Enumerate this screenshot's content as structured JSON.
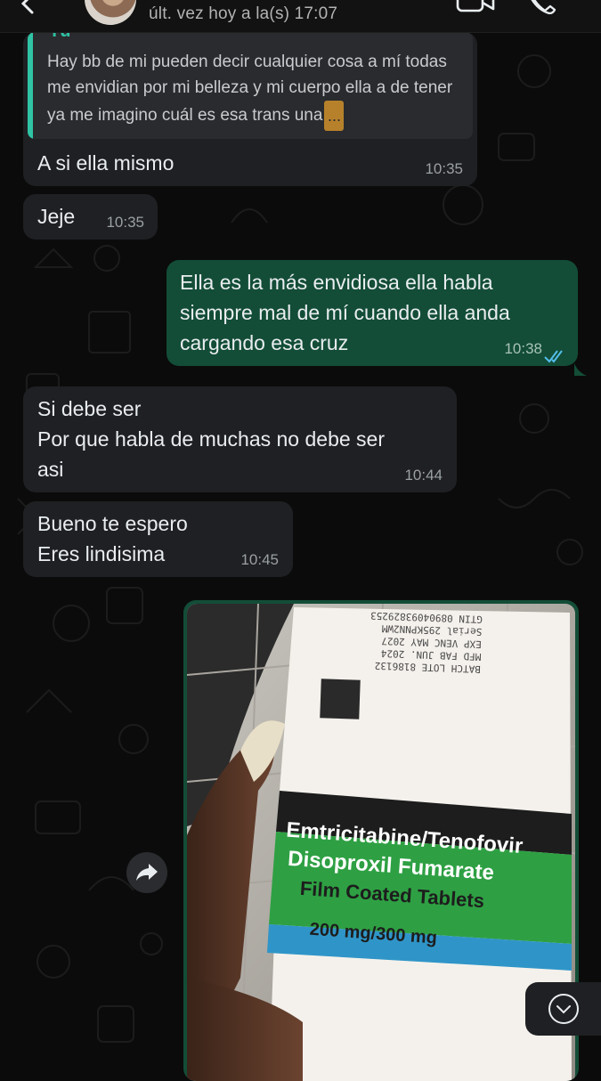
{
  "header": {
    "last_seen": "últ. vez hoy a la(s) 17:07"
  },
  "messages": [
    {
      "direction": "incoming",
      "quote_author": "Tú",
      "quote_text": "Hay bb de mi pueden decir cualquier cosa a mí todas me envidian por mi belleza y mi cuerpo ella a de tener ya me imagino cuál es esa trans una",
      "quote_more": "...",
      "text": "A si ella mismo",
      "time": "10:35"
    },
    {
      "direction": "incoming",
      "text": "Jeje",
      "time": "10:35"
    },
    {
      "direction": "outgoing",
      "lines": [
        "Ella es la más envidiosa ella habla",
        "siempre mal de mí cuando ella anda",
        "cargando esa cruz"
      ],
      "time": "10:38",
      "status": "read"
    },
    {
      "direction": "incoming",
      "lines": [
        "Si debe ser",
        "Por que habla de muchas no debe ser",
        "asi"
      ],
      "time": "10:44"
    },
    {
      "direction": "incoming",
      "lines": [
        "Bueno te espero",
        "Eres lindisima"
      ],
      "time": "10:45"
    },
    {
      "direction": "outgoing",
      "type": "image",
      "image": {
        "box_label_lines": [
          "Emtricitabine/Tenofovir",
          "Disoproxil Fumarate",
          "Film Coated Tablets"
        ],
        "box_dose": "200 mg/300 mg",
        "box_print_lines": [
          "BATCH LOTE 8186132",
          "MFD FAB   JUN. 2024",
          "EXP VENC   MAY 2027",
          "Serial 295KPNN2WM",
          "GTIN  08904093829253"
        ]
      }
    }
  ],
  "colors": {
    "incoming_bubble": "#1f2023",
    "outgoing_bubble": "#134d37",
    "read_ticks": "#53bdeb",
    "quote_accent": "#2fc3a4",
    "background": "#0b0b0b"
  },
  "icons": {
    "back": "chevron-left-icon",
    "video": "video-call-icon",
    "phone": "phone-call-icon",
    "forward": "forward-icon",
    "scroll": "chevron-down-icon"
  }
}
